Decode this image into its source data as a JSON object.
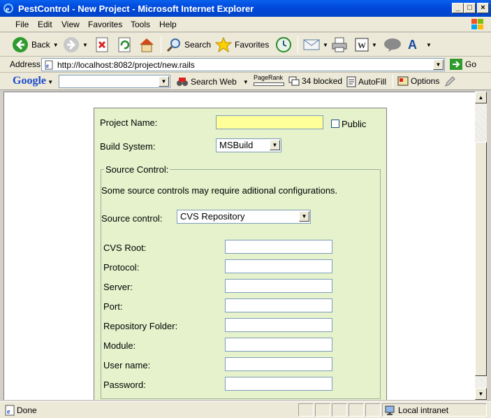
{
  "window": {
    "title": "PestControl - New Project - Microsoft Internet Explorer"
  },
  "menu": {
    "items": [
      "File",
      "Edit",
      "View",
      "Favorites",
      "Tools",
      "Help"
    ]
  },
  "toolbar": {
    "back_label": "Back",
    "search_label": "Search",
    "favorites_label": "Favorites"
  },
  "address": {
    "label": "Address",
    "url": "http://localhost:8082/project/new.rails",
    "go_label": "Go"
  },
  "googlebar": {
    "logo": "Google",
    "search_web_label": "Search Web",
    "pagerank_label": "PageRank",
    "blocked_label": "34 blocked",
    "autofill_label": "AutoFill",
    "options_label": "Options"
  },
  "form": {
    "project_name_label": "Project Name:",
    "project_name_value": "",
    "public_label": "Public",
    "build_system_label": "Build System:",
    "build_system_value": "MSBuild",
    "source_control_legend": "Source Control:",
    "note": "Some source controls may require aditional configurations.",
    "source_control_label": "Source control:",
    "source_control_value": "CVS Repository",
    "cvs_fields": [
      {
        "label": "CVS Root:",
        "value": ""
      },
      {
        "label": "Protocol:",
        "value": ""
      },
      {
        "label": "Server:",
        "value": ""
      },
      {
        "label": "Port:",
        "value": ""
      },
      {
        "label": "Repository Folder:",
        "value": ""
      },
      {
        "label": "Module:",
        "value": ""
      },
      {
        "label": "User name:",
        "value": ""
      },
      {
        "label": "Password:",
        "value": ""
      }
    ]
  },
  "status": {
    "text": "Done",
    "zone": "Local intranet"
  },
  "colors": {
    "titlebar": "#0a5ce6",
    "form_background": "#e5f2cc",
    "project_name_highlight": "#ffff99"
  }
}
